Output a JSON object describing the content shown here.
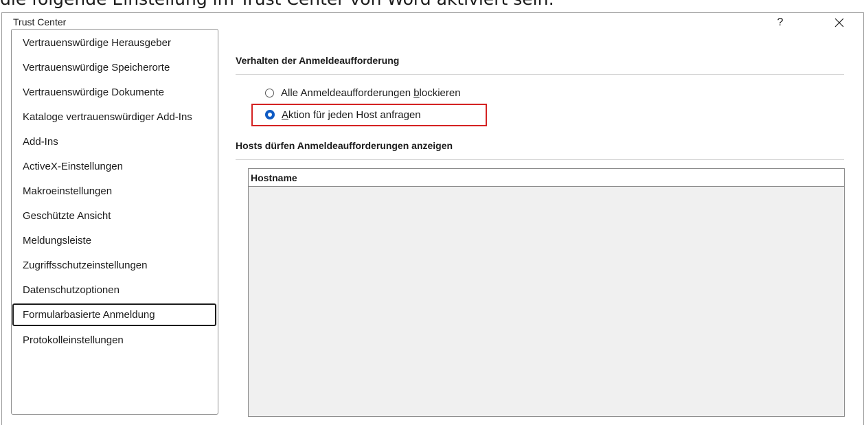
{
  "caption": "die folgende Einstellung im Trust Center von Word aktiviert sein:",
  "window": {
    "title": "Trust Center",
    "help_label": "?",
    "close_icon": "close-icon"
  },
  "sidebar": {
    "items": [
      {
        "label": "Vertrauenswürdige Herausgeber"
      },
      {
        "label": "Vertrauenswürdige Speicherorte"
      },
      {
        "label": "Vertrauenswürdige Dokumente"
      },
      {
        "label": "Kataloge vertrauenswürdiger Add-Ins"
      },
      {
        "label": "Add-Ins"
      },
      {
        "label": "ActiveX-Einstellungen"
      },
      {
        "label": "Makroeinstellungen"
      },
      {
        "label": "Geschützte Ansicht"
      },
      {
        "label": "Meldungsleiste"
      },
      {
        "label": "Zugriffsschutzeinstellungen"
      },
      {
        "label": "Datenschutzoptionen"
      },
      {
        "label": "Formularbasierte Anmeldung",
        "selected": true
      },
      {
        "label": "Protokolleinstellungen"
      }
    ]
  },
  "main": {
    "prompt_section": {
      "heading": "Verhalten der Anmeldeaufforderung",
      "options": [
        {
          "label_pre": "Alle Anmeldeaufforderungen ",
          "label_accel": "b",
          "label_post": "lockieren",
          "checked": false
        },
        {
          "label_pre": "",
          "label_accel": "A",
          "label_post": "ktion für jeden Host anfragen",
          "checked": true
        }
      ]
    },
    "hosts_section": {
      "heading": "Hosts dürfen Anmeldeaufforderungen anzeigen",
      "column_header": "Hostname",
      "rows": []
    }
  },
  "colors": {
    "accent": "#0f5bc4",
    "highlight_box": "#d42222",
    "list_background": "#f0f0f0"
  }
}
